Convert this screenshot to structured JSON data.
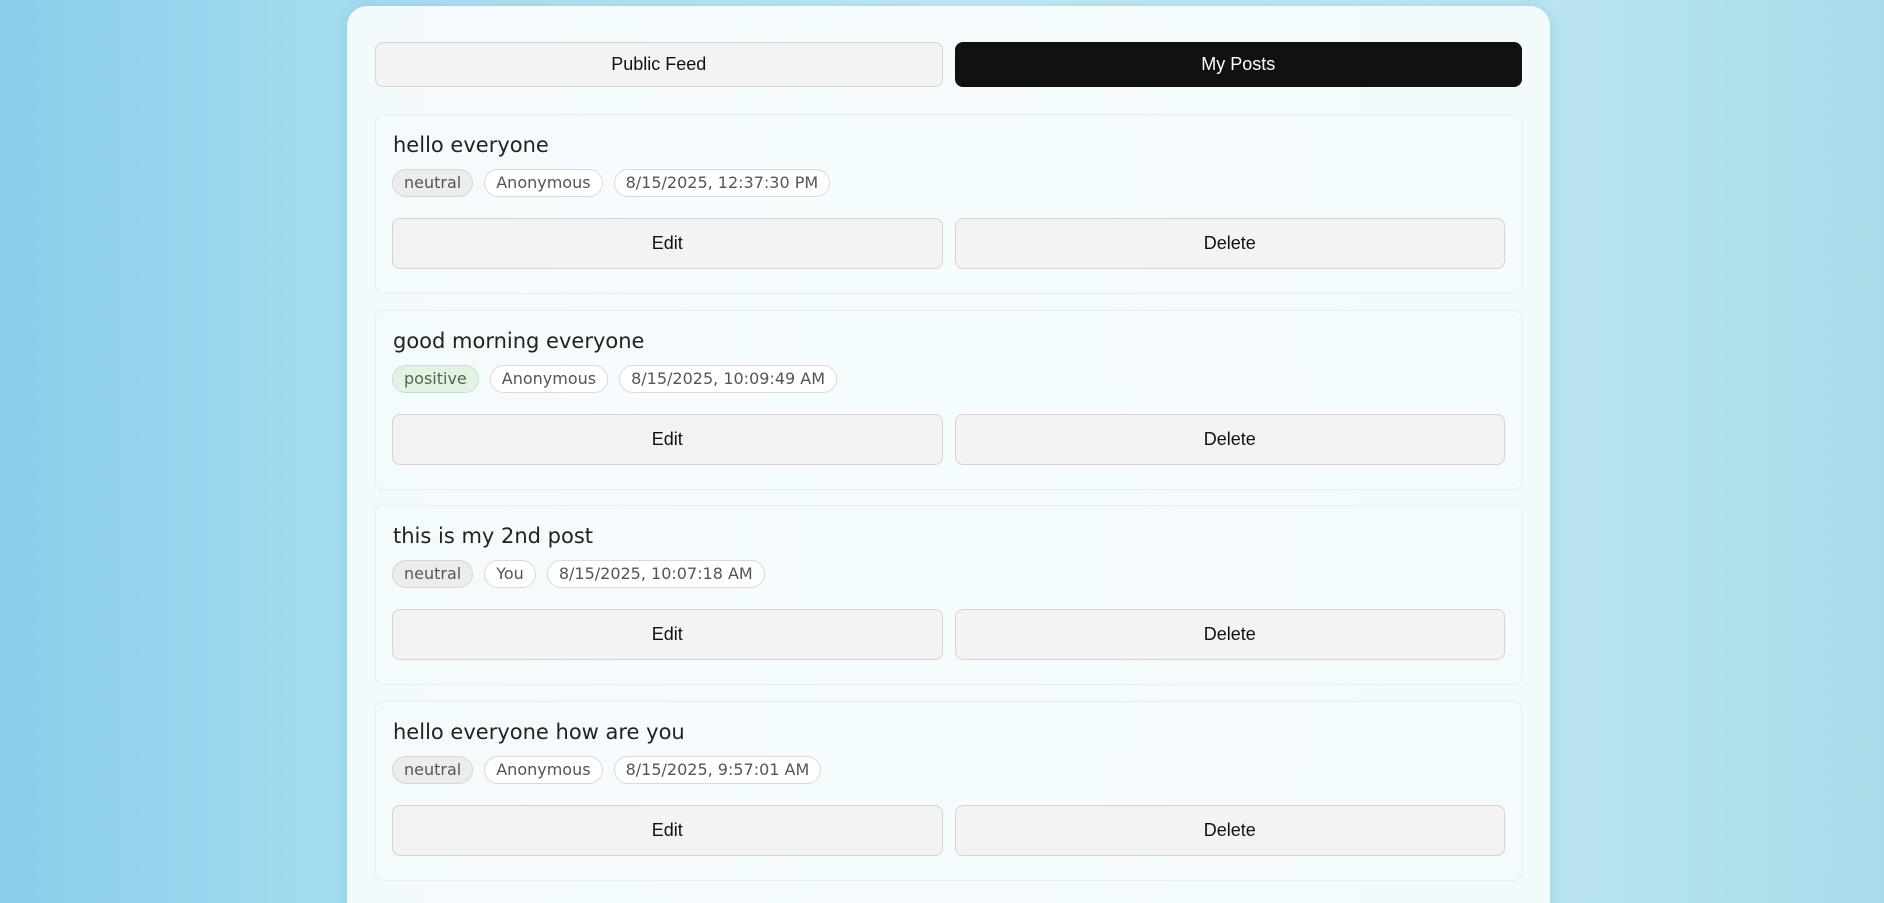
{
  "tabs": {
    "public_feed": "Public Feed",
    "my_posts": "My Posts",
    "active": "my_posts"
  },
  "colors": {
    "active_tab_bg": "#111111",
    "positive_badge_bg": "#e3f3e3",
    "neutral_badge_bg": "#ececec"
  },
  "posts": [
    {
      "title": "hello everyone",
      "sentiment": "neutral",
      "author": "Anonymous",
      "timestamp": "8/15/2025, 12:37:30 PM",
      "edit_label": "Edit",
      "delete_label": "Delete"
    },
    {
      "title": "good morning everyone",
      "sentiment": "positive",
      "author": "Anonymous",
      "timestamp": "8/15/2025, 10:09:49 AM",
      "edit_label": "Edit",
      "delete_label": "Delete"
    },
    {
      "title": "this is my 2nd post",
      "sentiment": "neutral",
      "author": "You",
      "timestamp": "8/15/2025, 10:07:18 AM",
      "edit_label": "Edit",
      "delete_label": "Delete"
    },
    {
      "title": "hello everyone how are you",
      "sentiment": "neutral",
      "author": "Anonymous",
      "timestamp": "8/15/2025, 9:57:01 AM",
      "edit_label": "Edit",
      "delete_label": "Delete"
    }
  ]
}
